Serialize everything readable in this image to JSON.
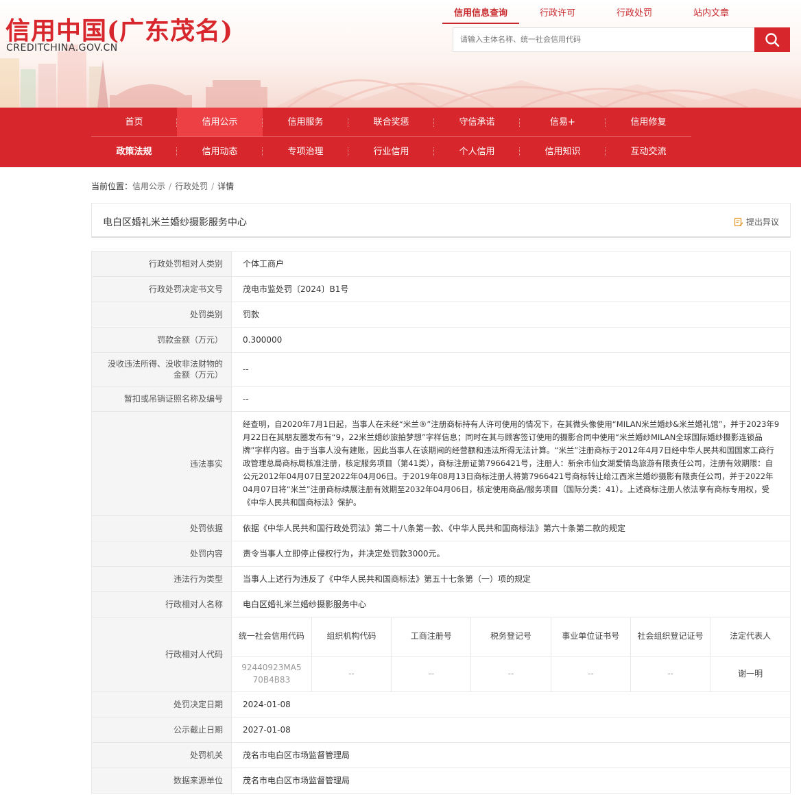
{
  "header": {
    "logo_cn": "信用中国(广东茂名)",
    "logo_en": "CREDITCHINA.GOV.CN",
    "top_links": [
      "信用信息查询",
      "行政许可",
      "行政处罚",
      "站内文章"
    ],
    "search_placeholder": "请输入主体名称、统一社会信用代码"
  },
  "nav": {
    "row1": [
      "首页",
      "信用公示",
      "信用服务",
      "联合奖惩",
      "守信承诺",
      "信易+",
      "信用修复"
    ],
    "row2": [
      "政策法规",
      "信用动态",
      "专项治理",
      "行业信用",
      "个人信用",
      "信用知识",
      "互动交流"
    ]
  },
  "breadcrumb": {
    "prefix": "当前位置：",
    "items": [
      "信用公示",
      "行政处罚",
      "详情"
    ]
  },
  "title": "电白区婚礼米兰婚纱摄影服务中心",
  "objection_label": "提出异议",
  "details": [
    {
      "label": "行政处罚相对人类别",
      "value": "个体工商户"
    },
    {
      "label": "行政处罚决定书文号",
      "value": "茂电市监处罚〔2024〕B1号"
    },
    {
      "label": "处罚类别",
      "value": "罚款"
    },
    {
      "label": "罚款金额（万元）",
      "value": "0.300000"
    },
    {
      "label": "没收违法所得、没收非法财物的金额（万元）",
      "value": "--"
    },
    {
      "label": "暂扣或吊销证照名称及编号",
      "value": "--"
    },
    {
      "label": "违法事实",
      "value": "经查明，自2020年7月1日起，当事人在未经“米兰®”注册商标持有人许可使用的情况下，在其微头像使用“MILAN米兰婚纱&米兰婚礼馆”，并于2023年9月22日在其朋友圈发布有“9，22米兰婚纱旅拍梦想”字样信息；同时在其与顾客签订使用的摄影合同中使用“米兰婚纱MILAN全球国际婚纱摄影连锁品牌”字样内容。由于当事人没有建账，因此当事人在该期间的经营额和违法所得无法计算。“米兰”注册商标于2012年4月7日经中华人民共和国国家工商行政管理总局商标局核准注册，核定服务项目（第41类），商标注册证第7966421号，注册人：新余市仙女湖爱情岛旅游有限责任公司，注册有效期限：自公元2012年04月07日至2022年04月06日。于2019年08月13日商标注册人将第7966421号商标转让给江西米兰婚纱摄影有限责任公司，并于2022年04月07日将“米兰”注册商标续展注册有效期至2032年04月06日，核定使用商品/服务项目（国际分类：41）。上述商标注册人依法享有商标专用权，受《中华人民共和国商标法》保护。"
    },
    {
      "label": "处罚依据",
      "value": "依据《中华人民共和国行政处罚法》第二十八条第一款、《中华人民共和国商标法》第六十条第二款的规定"
    },
    {
      "label": "处罚内容",
      "value": "责令当事人立即停止侵权行为，并决定处罚款3000元。"
    },
    {
      "label": "违法行为类型",
      "value": "当事人上述行为违反了《中华人民共和国商标法》第五十七条第（一）项的规定"
    },
    {
      "label": "行政相对人名称",
      "value": "电白区婚礼米兰婚纱摄影服务中心"
    }
  ],
  "code_row": {
    "label": "行政相对人代码",
    "headers": [
      "统一社会信用代码",
      "组织机构代码",
      "工商注册号",
      "税务登记号",
      "事业单位证书号",
      "社会组织登记证号",
      "法定代表人"
    ],
    "values": [
      "92440923MA570B4B83",
      "--",
      "--",
      "--",
      "--",
      "--",
      "谢一明"
    ]
  },
  "details_bottom": [
    {
      "label": "处罚决定日期",
      "value": "2024-01-08"
    },
    {
      "label": "公示截止日期",
      "value": "2027-01-08"
    },
    {
      "label": "处罚机关",
      "value": "茂名市电白区市场监督管理局"
    },
    {
      "label": "数据来源单位",
      "value": "茂名市电白区市场监督管理局"
    }
  ],
  "colors": {
    "brand_red": "#d7272c",
    "nav_active": "#ec4045"
  }
}
